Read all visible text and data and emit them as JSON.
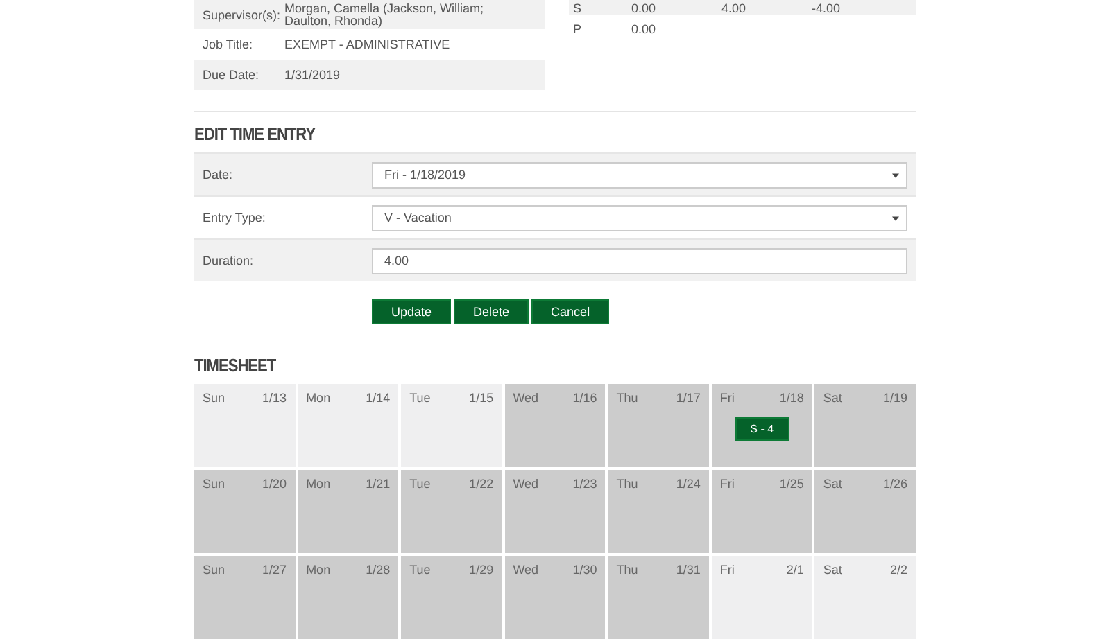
{
  "employee_info": [
    {
      "label": "Supervisor(s):",
      "value": "Morgan, Camella (Jackson, William; Daulton, Rhonda)"
    },
    {
      "label": "Job Title:",
      "value": "EXEMPT - ADMINISTRATIVE"
    },
    {
      "label": "Due Date:",
      "value": "1/31/2019"
    }
  ],
  "balances": [
    {
      "code": "S",
      "values": [
        "0.00",
        "4.00",
        "-4.00"
      ]
    },
    {
      "code": "P",
      "values": [
        "0.00"
      ]
    }
  ],
  "edit_time_entry": {
    "title": "EDIT TIME ENTRY",
    "fields": [
      {
        "kind": "select",
        "label": "Date:",
        "value": "Fri - 1/18/2019"
      },
      {
        "kind": "select",
        "label": "Entry Type:",
        "value": "V - Vacation"
      },
      {
        "kind": "text",
        "label": "Duration:",
        "value": "4.00"
      }
    ],
    "buttons": [
      "Update",
      "Delete",
      "Cancel"
    ]
  },
  "timesheet": {
    "title": "TIMESHEET",
    "weeks": [
      [
        {
          "day": "Sun",
          "date": "1/13",
          "in_period": false
        },
        {
          "day": "Mon",
          "date": "1/14",
          "in_period": false
        },
        {
          "day": "Tue",
          "date": "1/15",
          "in_period": false
        },
        {
          "day": "Wed",
          "date": "1/16",
          "in_period": true
        },
        {
          "day": "Thu",
          "date": "1/17",
          "in_period": true
        },
        {
          "day": "Fri",
          "date": "1/18",
          "in_period": true,
          "entries": [
            "S - 4"
          ]
        },
        {
          "day": "Sat",
          "date": "1/19",
          "in_period": true
        }
      ],
      [
        {
          "day": "Sun",
          "date": "1/20",
          "in_period": true
        },
        {
          "day": "Mon",
          "date": "1/21",
          "in_period": true
        },
        {
          "day": "Tue",
          "date": "1/22",
          "in_period": true
        },
        {
          "day": "Wed",
          "date": "1/23",
          "in_period": true
        },
        {
          "day": "Thu",
          "date": "1/24",
          "in_period": true
        },
        {
          "day": "Fri",
          "date": "1/25",
          "in_period": true
        },
        {
          "day": "Sat",
          "date": "1/26",
          "in_period": true
        }
      ],
      [
        {
          "day": "Sun",
          "date": "1/27",
          "in_period": true
        },
        {
          "day": "Mon",
          "date": "1/28",
          "in_period": true
        },
        {
          "day": "Tue",
          "date": "1/29",
          "in_period": true
        },
        {
          "day": "Wed",
          "date": "1/30",
          "in_period": true
        },
        {
          "day": "Thu",
          "date": "1/31",
          "in_period": true
        },
        {
          "day": "Fri",
          "date": "2/1",
          "in_period": false
        },
        {
          "day": "Sat",
          "date": "2/2",
          "in_period": false
        }
      ]
    ]
  }
}
